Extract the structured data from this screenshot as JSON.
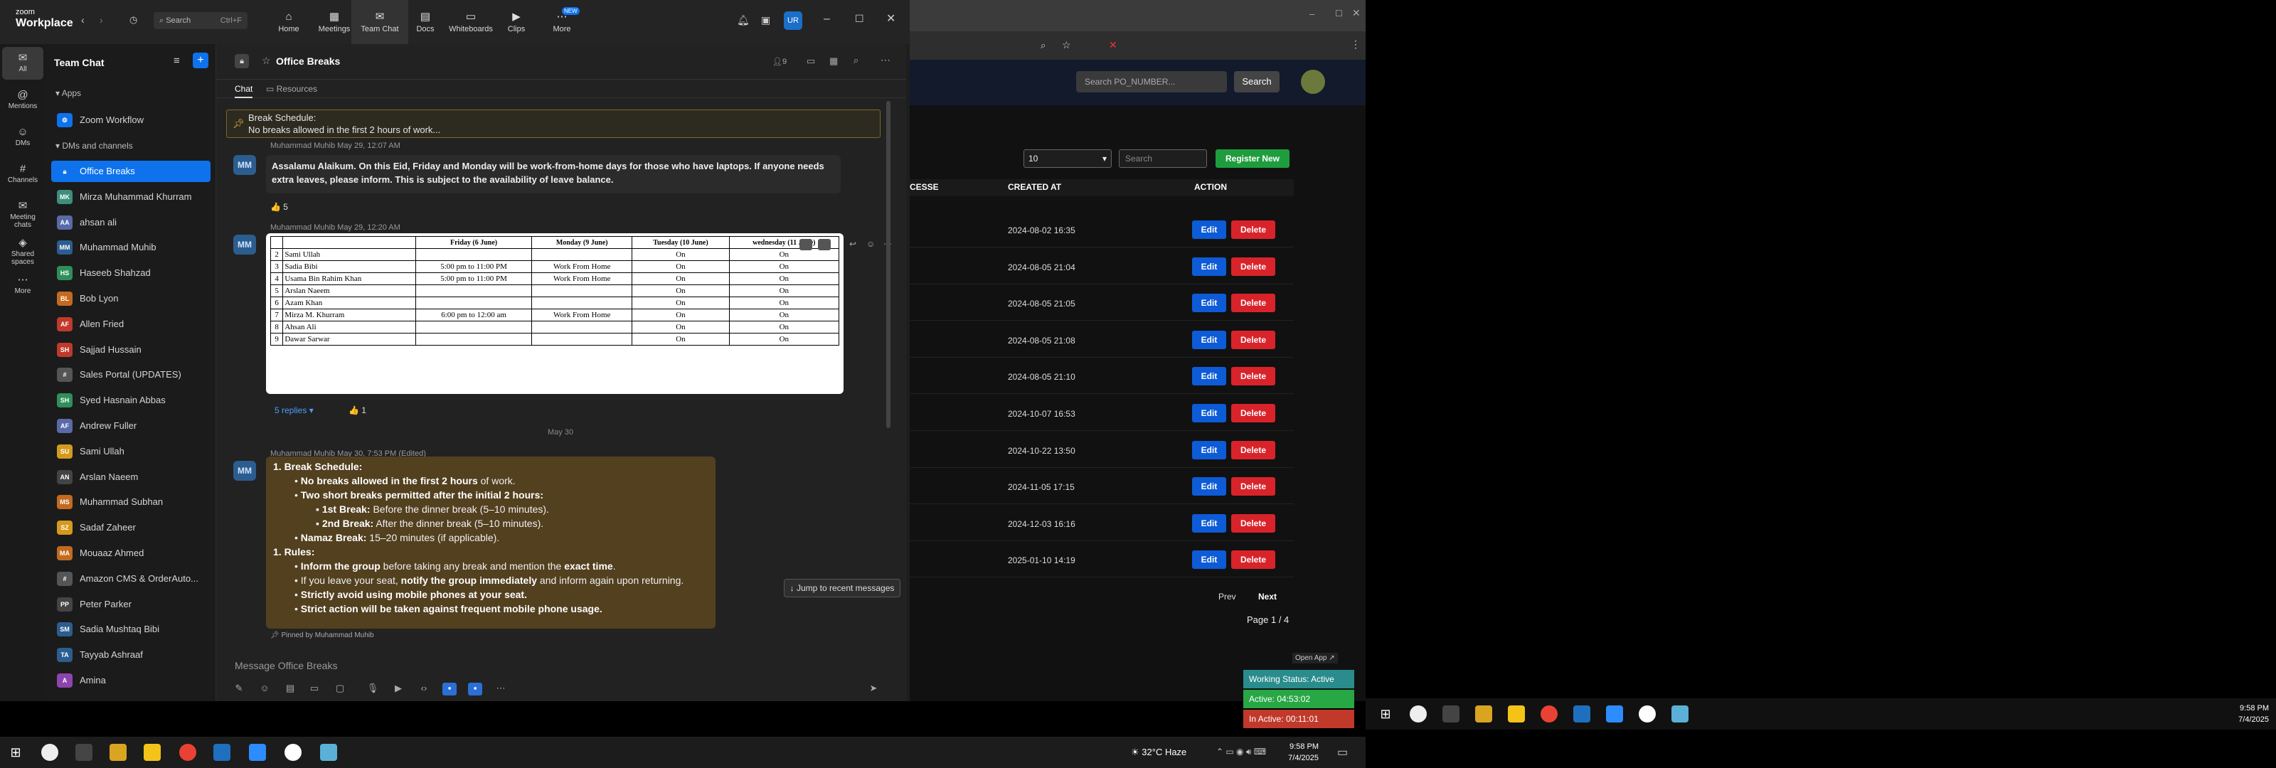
{
  "zoom": {
    "brand_top": "zoom",
    "brand_bottom": "Workplace",
    "search_label": "Search",
    "search_shortcut": "Ctrl+F",
    "avatar_initials": "UR",
    "tabs": [
      {
        "label": "Home",
        "icon": "home-icon"
      },
      {
        "label": "Meetings",
        "icon": "calendar-icon"
      },
      {
        "label": "Team Chat",
        "icon": "chat-icon"
      },
      {
        "label": "Docs",
        "icon": "doc-icon"
      },
      {
        "label": "Whiteboards",
        "icon": "whiteboard-icon"
      },
      {
        "label": "Clips",
        "icon": "clips-icon"
      },
      {
        "label": "More",
        "icon": "more-icon",
        "badge": "NEW"
      }
    ],
    "rail": [
      {
        "label": "All",
        "icon": "chat-icon"
      },
      {
        "label": "Mentions",
        "icon": "at-icon"
      },
      {
        "label": "DMs",
        "icon": "people-icon"
      },
      {
        "label": "Channels",
        "icon": "hash-icon"
      },
      {
        "label": "Meeting chats",
        "icon": "meeting-chat-icon"
      },
      {
        "label": "Shared spaces",
        "icon": "shared-icon"
      },
      {
        "label": "More",
        "icon": "ellipsis-icon"
      }
    ],
    "sidebar": {
      "title": "Team Chat",
      "apps_header": "Apps",
      "app_item": "Zoom Workflow",
      "dms_header": "DMs and channels",
      "items": [
        {
          "name": "Office Breaks",
          "initials": "",
          "color": "#0e72ed",
          "active": true
        },
        {
          "name": "Mirza Muhammad Khurram",
          "initials": "MK",
          "color": "#3e8e7e"
        },
        {
          "name": "ahsan ali",
          "initials": "AA",
          "color": "#5a6aa8"
        },
        {
          "name": "Muhammad Muhib",
          "initials": "MM",
          "color": "#2c5d8f"
        },
        {
          "name": "Haseeb Shahzad",
          "initials": "HS",
          "color": "#2f8f5a"
        },
        {
          "name": "Bob Lyon",
          "initials": "BL",
          "color": "#c36a1f"
        },
        {
          "name": "Allen Fried",
          "initials": "AF",
          "color": "#c0392b"
        },
        {
          "name": "Sajjad Hussain",
          "initials": "SH",
          "color": "#c0392b"
        },
        {
          "name": "Sales Portal (UPDATES)",
          "initials": "",
          "color": "#555"
        },
        {
          "name": "Syed Hasnain Abbas",
          "initials": "SH",
          "color": "#2f8f5a"
        },
        {
          "name": "Andrew Fuller",
          "initials": "AF",
          "color": "#5a6aa8"
        },
        {
          "name": "Sami Ullah",
          "initials": "SU",
          "color": "#d49a1c"
        },
        {
          "name": "Arslan Naeem",
          "initials": "AN",
          "color": "#444"
        },
        {
          "name": "Muhammad Subhan",
          "initials": "MS",
          "color": "#c36a1f"
        },
        {
          "name": "Sadaf Zaheer",
          "initials": "SZ",
          "color": "#d49a1c"
        },
        {
          "name": "Mouaaz Ahmed",
          "initials": "MA",
          "color": "#c36a1f"
        },
        {
          "name": "Amazon CMS & OrderAuto...",
          "initials": "",
          "color": "#555"
        },
        {
          "name": "Peter Parker",
          "initials": "PP",
          "color": "#444"
        },
        {
          "name": "Sadia Mushtaq Bibi",
          "initials": "SM",
          "color": "#2c5d8f"
        },
        {
          "name": "Tayyab Ashraaf",
          "initials": "TA",
          "color": "#2c5d8f"
        },
        {
          "name": "Amina",
          "initials": "A",
          "color": "#8e44ad"
        }
      ]
    },
    "chat": {
      "channel": "Office Breaks",
      "member_count": "9",
      "tab_chat": "Chat",
      "tab_resources": "Resources",
      "pinned_title": "Break Schedule:",
      "pinned_body": "No breaks allowed in the first 2 hours of work...",
      "msg1_meta": "Muhammad Muhib  May 29, 12:07 AM",
      "msg1_text": "Assalamu Alaikum. On this Eid, Friday and Monday will be work-from-home days for those who have laptops. If anyone needs extra leaves, please inform. This is subject to the availability of leave balance.",
      "msg1_reaction": "👍 5",
      "msg2_meta": "Muhammad Muhib  May 29, 12:20 AM",
      "sheet_headers": [
        "",
        "",
        "Friday (6 June)",
        "Monday (9 June)",
        "Tuesday (10 June)",
        "wednesday (11 June)"
      ],
      "sheet_rows": [
        [
          "2",
          "Sami Ullah",
          "",
          "",
          "On",
          "On"
        ],
        [
          "3",
          "Sadia Bibi",
          "5:00 pm to 11:00 PM",
          "Work From Home",
          "On",
          "On"
        ],
        [
          "4",
          "Usama Bin Rahim Khan",
          "5:00 pm to 11:00 PM",
          "Work From Home",
          "On",
          "On"
        ],
        [
          "5",
          "Arslan Naeem",
          "",
          "",
          "On",
          "On"
        ],
        [
          "6",
          "Azam Khan",
          "",
          "",
          "On",
          "On"
        ],
        [
          "7",
          "Mirza M. Khurram",
          "6:00 pm to 12:00 am",
          "Work From Home",
          "On",
          "On"
        ],
        [
          "8",
          "Ahsan Ali",
          "",
          "",
          "On",
          "On"
        ],
        [
          "9",
          "Dawar Sarwar",
          "",
          "",
          "On",
          "On"
        ]
      ],
      "replies": "5 replies",
      "msg2_reaction": "👍 1",
      "date_divider": "May 30",
      "msg3_meta": "Muhammad Muhib  May 30, 7:53 PM (Edited)",
      "notes": {
        "h1": "1. Break Schedule:",
        "l1a": "No breaks allowed in the first 2 hours",
        "l1a_end": " of work.",
        "l1b": "Two short breaks permitted after the initial 2 hours:",
        "l1b1_bold": "1st Break:",
        "l1b1": " Before the dinner break (5–10 minutes).",
        "l1b2_bold": "2nd Break:",
        "l1b2": " After the dinner break (5–10 minutes).",
        "l1c_bold": "Namaz Break:",
        "l1c": " 15–20 minutes (if applicable).",
        "h2": "1. Rules:",
        "r1_bold": "Inform the group",
        "r1_mid": " before taking any break and mention the ",
        "r1_bold2": "exact time",
        "r1_end": ".",
        "r2_start": "If you leave your seat, ",
        "r2_bold": "notify the group immediately",
        "r2_end": " and inform again upon returning.",
        "r3": "Strictly avoid using mobile phones at your seat.",
        "r4": "Strict action will be taken against frequent mobile phone usage."
      },
      "pinned_by": "Pinned by Muhammad Muhib",
      "jump": "Jump to recent messages",
      "compose_placeholder": "Message Office Breaks"
    }
  },
  "browser": {
    "search_placeholder": "Search PO_NUMBER...",
    "search_button": "Search",
    "page_size": "10",
    "table_search_placeholder": "Search",
    "register_button": "Register New",
    "columns": [
      "CESSE",
      "CREATED AT",
      "ACTION"
    ],
    "rows": [
      "2024-08-02 16:35",
      "2024-08-05 21:04",
      "2024-08-05 21:05",
      "2024-08-05 21:08",
      "2024-08-05 21:10",
      "2024-10-07 16:53",
      "2024-10-22 13:50",
      "2024-11-05 17:15",
      "2024-12-03 16:16",
      "2025-01-10 14:19"
    ],
    "edit_label": "Edit",
    "delete_label": "Delete",
    "prev_label": "Prev",
    "next_label": "Next",
    "page_label": "Page 1 / 4",
    "open_app": "Open App ↗"
  },
  "status": {
    "working": "Working Status: Active",
    "active": "Active: 04:53:02",
    "inactive": "In Active: 00:11:01"
  },
  "taskbar": {
    "weather": "32°C  Haze",
    "time": "9:58 PM",
    "date": "7/4/2025"
  }
}
